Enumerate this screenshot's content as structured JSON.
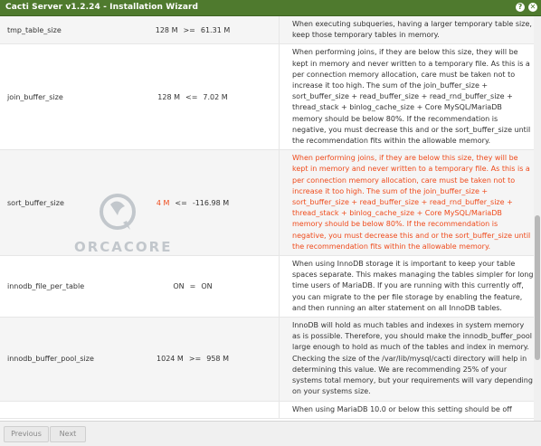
{
  "window": {
    "title": "Cacti Server v1.2.24 - Installation Wizard"
  },
  "rows": [
    {
      "name": "tmp_table_size",
      "current": "128 M",
      "op": ">=",
      "recommended": "61.31 M",
      "warn": false,
      "desc": [
        "When executing subqueries, having a larger temporary table size,",
        "keep those temporary tables in memory."
      ]
    },
    {
      "name": "join_buffer_size",
      "current": "128 M",
      "op": "<=",
      "recommended": "7.02 M",
      "warn": false,
      "desc": [
        "When performing joins, if they are below this size, they will be",
        "kept in memory and never written to a temporary file. As this is a",
        "per connection memory allocation, care must be taken not to",
        "increase it too high. The sum of the join_buffer_size +",
        "sort_buffer_size + read_buffer_size + read_rnd_buffer_size +",
        "thread_stack + binlog_cache_size + Core MySQL/MariaDB",
        "memory should be below 80%. If the recommendation is",
        "negative, you must decrease this and or the sort_buffer_size until",
        "the recommendation fits within the allowable memory."
      ]
    },
    {
      "name": "sort_buffer_size",
      "current": "4 M",
      "op": "<=",
      "recommended": "-116.98 M",
      "warn": true,
      "desc": [
        "When performing joins, if they are below this size, they will be",
        "kept in memory and never written to a temporary file. As this is a",
        "per connection memory allocation, care must be taken not to",
        "increase it too high. The sum of the join_buffer_size +",
        "sort_buffer_size + read_buffer_size + read_rnd_buffer_size +",
        "thread_stack + binlog_cache_size + Core MySQL/MariaDB",
        "memory should be below 80%. If the recommendation is",
        "negative, you must decrease this and or the sort_buffer_size until",
        "the recommendation fits within the allowable memory."
      ]
    },
    {
      "name": "innodb_file_per_table",
      "current": "ON",
      "op": "=",
      "recommended": "ON",
      "warn": false,
      "desc": [
        "When using InnoDB storage it is important to keep your table",
        "spaces separate. This makes managing the tables simpler for long",
        "time users of MariaDB. If you are running with this currently off,",
        "you can migrate to the per file storage by enabling the feature,",
        "and then running an alter statement on all InnoDB tables."
      ]
    },
    {
      "name": "innodb_buffer_pool_size",
      "current": "1024 M",
      "op": ">=",
      "recommended": "958 M",
      "warn": false,
      "desc": [
        "InnoDB will hold as much tables and indexes in system memory",
        "as is possible. Therefore, you should make the innodb_buffer_pool",
        "large enough to hold as much of the tables and index in memory.",
        "Checking the size of the /var/lib/mysql/cacti directory will help in",
        "determining this value. We are recommending 25% of your",
        "systems total memory, but your requirements will vary depending",
        "on your systems size."
      ]
    },
    {
      "name": "",
      "current": "",
      "op": "",
      "recommended": "",
      "warn": false,
      "desc": [
        "When using MariaDB 10.0 or below this setting should be off"
      ]
    }
  ],
  "watermark": {
    "text": "ORCACORE"
  },
  "footer": {
    "previous_label": "Previous",
    "next_label": "Next"
  },
  "colors": {
    "titlebar": "#4f7a2e",
    "warning": "#ef4b1c"
  },
  "icons": {
    "help": "help-icon",
    "close": "close-icon"
  }
}
